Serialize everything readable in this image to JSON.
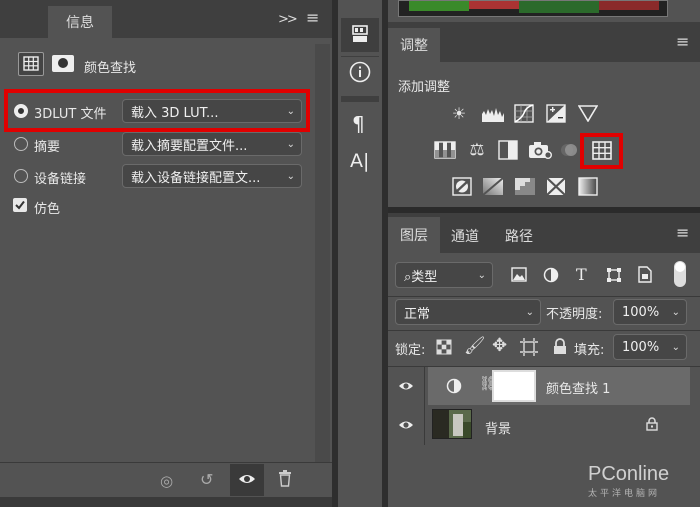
{
  "left_panel": {
    "tab_label": "信息",
    "expand_icon": "double-chevron-right",
    "menu_icon": "hamburger",
    "title": "颜色查找",
    "options": [
      {
        "label": "3DLUT 文件",
        "value": "载入 3D LUT...",
        "checked": true
      },
      {
        "label": "摘要",
        "value": "载入摘要配置文件..."
      },
      {
        "label": "设备链接",
        "value": "载入设备链接配置文..."
      }
    ],
    "dither_label": "仿色",
    "highlight_color": "#e00000"
  },
  "middle_toolbar": {
    "tools": [
      "properties-icon",
      "info-icon",
      "paragraph-icon",
      "character-icon"
    ],
    "paragraph_glyph": "¶",
    "character_glyph": "A|"
  },
  "adjustments": {
    "tab_label": "调整",
    "add_label": "添加调整"
  },
  "layers_panel": {
    "tabs": [
      "图层",
      "通道",
      "路径"
    ],
    "filter_label": "类型",
    "blend_mode": "正常",
    "opacity_label": "不透明度:",
    "opacity_value": "100%",
    "lock_label": "锁定:",
    "fill_label": "填充:",
    "fill_value": "100%",
    "layers": [
      {
        "name": "颜色查找 1"
      },
      {
        "name": "背景"
      }
    ]
  },
  "watermark": {
    "brand": "PConline",
    "sub": "太平洋电脑网"
  }
}
